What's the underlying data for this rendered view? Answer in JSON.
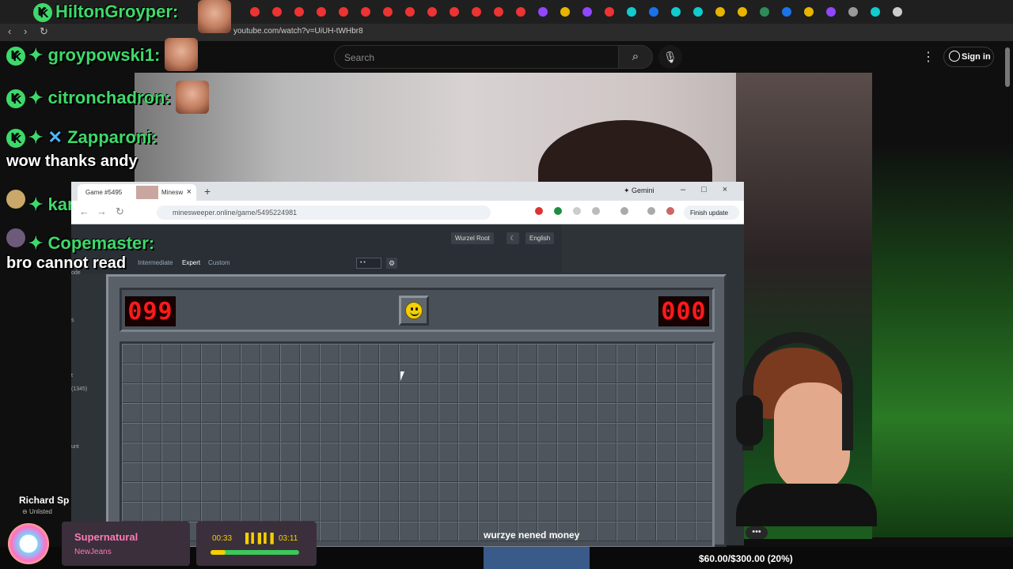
{
  "browser": {
    "url": "youtube.com/watch?v=UiUH-tWHbr8"
  },
  "youtube": {
    "search_placeholder": "Search",
    "search_icon": "search-icon",
    "mic_icon": "mic-icon",
    "signin_label": "Sign in",
    "channel_name": "Richard Sp",
    "visibility": "Unlisted",
    "menu_dots": "•••"
  },
  "chat": {
    "messages": [
      {
        "user": "HiltonGroyper:",
        "text": ""
      },
      {
        "user": "groypowski1:",
        "text": ""
      },
      {
        "user": "citronchadron:",
        "text": ""
      },
      {
        "user": "Zapparoni:",
        "text": "wow thanks andy"
      },
      {
        "user": "kamasta:",
        "text": ""
      },
      {
        "user": "Copemaster:",
        "text": "bro cannot read"
      }
    ],
    "badge_letter": "K"
  },
  "inner_browser": {
    "tab_title": "Game #5495",
    "tab_title2": "Minesw",
    "gemini_label": "✦ Gemini",
    "url": "minesweeper.online/game/5495224981",
    "finish_update": "Finish update"
  },
  "site": {
    "menu": [
      "Intermediate",
      "Expert",
      "Custom"
    ],
    "user_label": "Wurzel Root",
    "language_label": "English",
    "select_value": "• •",
    "side_labels": [
      "ode",
      "s",
      "t",
      "(1345)",
      "unt"
    ]
  },
  "minesweeper": {
    "mines_left": "099",
    "timer": "000",
    "rows": 10,
    "cols": 30
  },
  "music": {
    "title": "Supernatural",
    "artist": "NewJeans",
    "elapsed": "00:33",
    "total": "03:11",
    "progress": 0.17
  },
  "caption": "wurzye nened money",
  "goal": "$60.00/$300.00 (20%)",
  "colors": {
    "chat_green": "#3ed96a",
    "counter_red": "#ff1a1a",
    "music_pink": "#ff7ab8",
    "music_yellow": "#f5d000"
  }
}
